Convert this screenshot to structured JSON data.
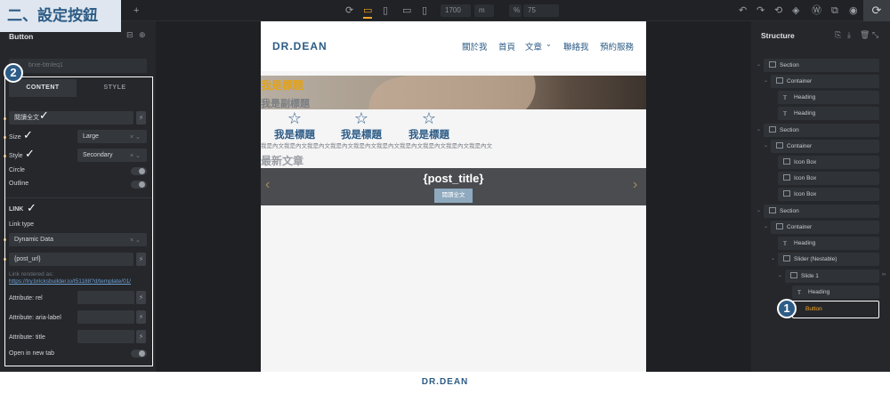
{
  "step_label": "二、設定按鈕",
  "toolbar": {
    "width_value": "1700",
    "unit_label": "%",
    "zoom_value": "75"
  },
  "left_panel": {
    "title": "Button",
    "element_id": "brxe-btnleq1",
    "tabs": [
      "CONTENT",
      "STYLE"
    ],
    "text_field": "閱讀全文",
    "size_label": "Size",
    "size_value": "Large",
    "style_label": "Style",
    "style_value": "Secondary",
    "circle_label": "Circle",
    "outline_label": "Outline",
    "link_section": "LINK",
    "link_type_label": "Link type",
    "link_type_value": "Dynamic Data",
    "link_value": "{post_url}",
    "link_rendered_label": "Link rendered as:",
    "link_rendered_url": "https://try.bricksbuilder.io/t51188?d/template/01/",
    "attr_rel": "Attribute: rel",
    "attr_aria": "Attribute: aria-label",
    "attr_title": "Attribute: title",
    "new_tab": "Open in new tab"
  },
  "badges": [
    "1",
    "2"
  ],
  "site": {
    "logo": "DR.DEAN",
    "nav": [
      "關於我",
      "首頁",
      "文章",
      "聯絡我",
      "預約服務"
    ],
    "hero_title": "我是標題",
    "hero_subtitle": "我是副標題",
    "features": [
      "我是標題",
      "我是標題",
      "我是標題"
    ],
    "body_text": "我是內文我是內文我是內文我是內文我是內文我是內文我是內文我是內文我是內文我是內文",
    "latest_heading": "最新文章",
    "slider_title": "{post_title}",
    "slider_button": "閱讀全文"
  },
  "structure": {
    "title": "Structure",
    "nodes": [
      {
        "label": "Section"
      },
      {
        "label": "Container"
      },
      {
        "label": "Heading"
      },
      {
        "label": "Heading"
      },
      {
        "label": "Section"
      },
      {
        "label": "Container"
      },
      {
        "label": "Icon Box"
      },
      {
        "label": "Icon Box"
      },
      {
        "label": "Icon Box"
      },
      {
        "label": "Section"
      },
      {
        "label": "Container"
      },
      {
        "label": "Heading"
      },
      {
        "label": "Slider (Nestable)"
      },
      {
        "label": "Slide 1"
      },
      {
        "label": "Heading"
      },
      {
        "label": "Button"
      }
    ]
  },
  "footer_logo": "DR.DEAN",
  "colors": {
    "accent": "#f5a623",
    "brand": "#2d5c86",
    "panel": "#25272b"
  }
}
